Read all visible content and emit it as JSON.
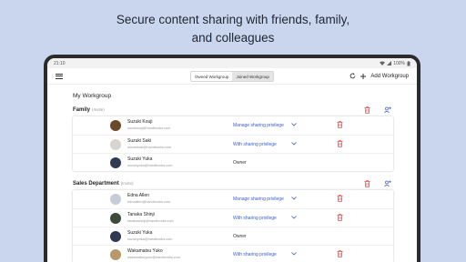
{
  "headline": {
    "line1": "Secure content sharing with friends, family,",
    "line2": "and colleagues"
  },
  "status_bar": {
    "time": "21:10",
    "battery": "100%"
  },
  "app_bar": {
    "tabs": [
      {
        "label": "Owned Workgroup",
        "active": true
      },
      {
        "label": "Joined Workgroup",
        "active": false
      }
    ],
    "add_workgroup_label": "Add Workgroup"
  },
  "page_title": "My Workgroup",
  "groups": [
    {
      "name": "Family",
      "invite_label": "(Invite)",
      "members": [
        {
          "name": "Suzuki Kouji",
          "email": "suzukiouji@handbooks.com",
          "privilege": "Manage sharing privilege",
          "role": "",
          "avatar_color": "#6b4a2a"
        },
        {
          "name": "Suzuki Saki",
          "email": "suzukisaki@handbooks.com",
          "privilege": "With sharing privilege",
          "role": "",
          "avatar_color": "#d8d4cf"
        },
        {
          "name": "Suzuki Yuka",
          "email": "suzukiyuka@handbooks.com",
          "privilege": "",
          "role": "Owner",
          "avatar_color": "#2f3b52"
        }
      ]
    },
    {
      "name": "Sales Department",
      "invite_label": "(Invite)",
      "members": [
        {
          "name": "Edna Allen",
          "email": "ednaallen@handbooks.com",
          "privilege": "Manage sharing privilege",
          "role": "",
          "avatar_color": "#c7cdd6"
        },
        {
          "name": "Tanaka Shinji",
          "email": "tanakashinji@handbooks.com",
          "privilege": "With sharing privilege",
          "role": "",
          "avatar_color": "#3d4a3a"
        },
        {
          "name": "Suzuki Yuka",
          "email": "suzukiyuka@handbooks.com",
          "privilege": "",
          "role": "Owner",
          "avatar_color": "#2f3b52"
        },
        {
          "name": "Wakamatsu Yuko",
          "email": "wakamatsuyuko@handbooks.com",
          "privilege": "With sharing privilege",
          "role": "",
          "avatar_color": "#b89a6a"
        }
      ]
    }
  ],
  "colors": {
    "accent": "#3b5ccc",
    "delete": "#e05555",
    "background": "#c9d6ee"
  },
  "icons": {
    "menu": "hamburger-icon",
    "refresh": "refresh-icon",
    "add": "plus-icon",
    "delete": "trash-icon",
    "add_user": "add-person-icon",
    "dropdown": "chevron-down-icon"
  }
}
